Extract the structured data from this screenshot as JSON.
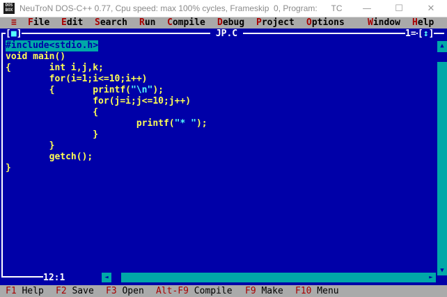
{
  "window": {
    "title": "NeuTroN DOS-C++ 0.77, Cpu speed: max 100% cycles, Frameskip  0, Program:      TC",
    "icon_line1": "DOS",
    "icon_line2": "BOX",
    "minimize": "—",
    "maximize": "☐",
    "close": "✕"
  },
  "menu": {
    "system": "≡",
    "items": [
      {
        "hot": "F",
        "rest": "ile"
      },
      {
        "hot": "E",
        "rest": "dit"
      },
      {
        "hot": "S",
        "rest": "earch"
      },
      {
        "hot": "R",
        "rest": "un"
      },
      {
        "hot": "C",
        "rest": "ompile"
      },
      {
        "hot": "D",
        "rest": "ebug"
      },
      {
        "hot": "P",
        "rest": "roject"
      },
      {
        "hot": "O",
        "rest": "ptions"
      },
      {
        "hot": "W",
        "rest": "indow"
      },
      {
        "hot": "H",
        "rest": "elp"
      }
    ]
  },
  "editor": {
    "file_name": "JP.C",
    "close_box": "[■]",
    "window_number": "1",
    "zoom_box": "[↕]",
    "cursor_position": "12:1",
    "code_lines": [
      "#include<stdio.h>",
      "void main()",
      "{       int i,j,k;",
      "        for(i=1;i<=10;i++)",
      "        {       printf(\"\\n\");",
      "                for(j=i;j<=10;j++)",
      "                {",
      "                        printf(\"* \");",
      "                }",
      "        }",
      "        getch();",
      "}"
    ]
  },
  "statusbar": [
    {
      "key": "F1",
      "label": " Help"
    },
    {
      "key": "F2",
      "label": " Save"
    },
    {
      "key": "F3",
      "label": " Open"
    },
    {
      "key": "Alt-F9",
      "label": " Compile"
    },
    {
      "key": "F9",
      "label": " Make"
    },
    {
      "key": "F10",
      "label": " Menu"
    }
  ],
  "colors": {
    "background": "#0000a8",
    "code_text": "#ffff54",
    "menu_bg": "#aaaaaa",
    "hotkey": "#a80000",
    "scrollbar": "#00a8a8"
  }
}
